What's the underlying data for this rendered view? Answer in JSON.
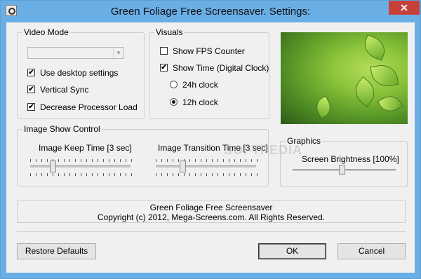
{
  "window": {
    "title": "Green Foliage Free Screensaver. Settings:",
    "close_glyph": "✕",
    "app_icon": "screensaver-app-icon"
  },
  "video_mode": {
    "legend": "Video Mode",
    "combo_value": "",
    "options": [
      {
        "label": "Use desktop settings",
        "checked": true
      },
      {
        "label": "Vertical Sync",
        "checked": true
      },
      {
        "label": "Decrease Processor Load",
        "checked": true
      }
    ]
  },
  "visuals": {
    "legend": "Visuals",
    "show_fps": {
      "label": "Show FPS Counter",
      "checked": false
    },
    "show_time": {
      "label": "Show Time (Digital Clock)",
      "checked": true
    },
    "clock_24": {
      "label": "24h clock",
      "selected": false
    },
    "clock_12": {
      "label": "12h clock",
      "selected": true
    }
  },
  "image_show": {
    "legend": "Image Show Control",
    "keep_time": {
      "label": "Image Keep Time [3 sec]",
      "position": 0.24
    },
    "transition_time": {
      "label": "Image Transition Time [3 sec]",
      "position": 0.24
    }
  },
  "graphics": {
    "legend": "Graphics",
    "brightness": {
      "label": "Screen Brightness [100%]",
      "position": 0.5
    }
  },
  "info": {
    "line1": "Green Foliage Free Screensaver",
    "line2": "Copyright (c) 2012, Mega-Screens.com. All Rights Reserved."
  },
  "buttons": {
    "restore": "Restore Defaults",
    "ok": "OK",
    "cancel": "Cancel"
  },
  "check_glyph": "✔",
  "watermark": "SOFTPEDIA"
}
